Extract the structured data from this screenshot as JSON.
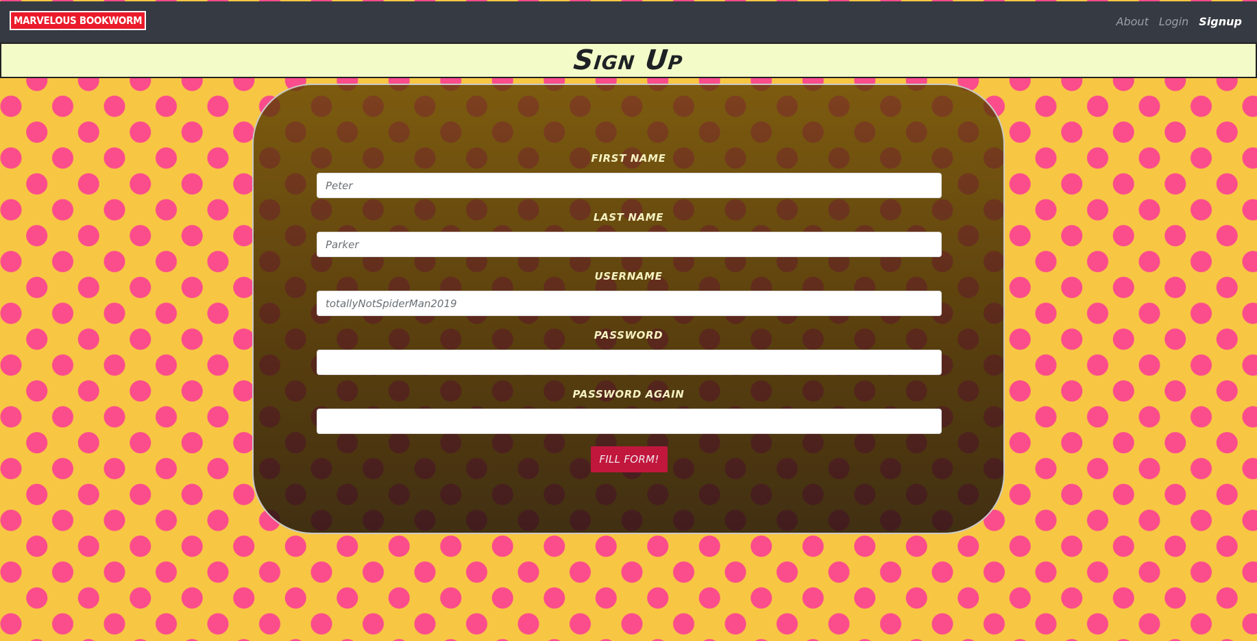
{
  "navbar": {
    "brand": "MARVELOUS BOOKWORM",
    "links": [
      {
        "label": "About",
        "active": false
      },
      {
        "label": "Login",
        "active": false
      },
      {
        "label": "Signup",
        "active": true
      }
    ]
  },
  "header": {
    "title": "Sign Up"
  },
  "form": {
    "fields": [
      {
        "label": "FIRST NAME",
        "value": "Peter",
        "type": "text"
      },
      {
        "label": "LAST NAME",
        "value": "Parker",
        "type": "text"
      },
      {
        "label": "USERNAME",
        "value": "totallyNotSpiderMan2019",
        "type": "text"
      },
      {
        "label": "PASSWORD",
        "value": "",
        "type": "password"
      },
      {
        "label": "PASSWORD AGAIN",
        "value": "",
        "type": "password"
      }
    ],
    "submit_label": "FILL FORM!"
  },
  "colors": {
    "background": "#f7c744",
    "dots": "#fb4c8c",
    "navbar": "#363a42",
    "brand": "#ea1b2a",
    "title_bar": "#f3fbc9",
    "submit": "#c1173d"
  }
}
